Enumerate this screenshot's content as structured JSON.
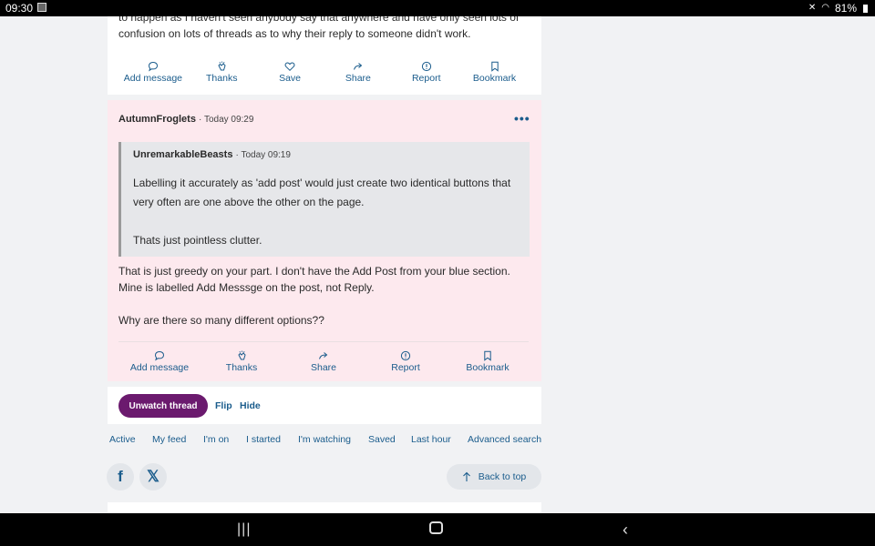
{
  "status_bar": {
    "time": "09:30",
    "battery": "81%"
  },
  "post1": {
    "text_lines": [
      "to happen as I haven't seen anybody say that anywhere and have only seen lots of",
      "confusion on lots of threads as to why their reply to someone didn't work."
    ],
    "actions": [
      "Add message",
      "Thanks",
      "Save",
      "Share",
      "Report",
      "Bookmark"
    ]
  },
  "post2": {
    "author": "AutumnFroglets",
    "time": "· Today 09:29",
    "more": "•••",
    "quote": {
      "author": "UnremarkableBeasts",
      "time": "· Today 09:19",
      "lines": [
        "Labelling it accurately as 'add post' would just create two identical buttons that",
        "very often are one above the other on the page.",
        "Thats just pointless clutter."
      ]
    },
    "body_lines": [
      "That is just greedy on your part. I don't have the Add Post from your blue section.",
      "Mine is labelled Add Messsge on the post, not Reply.",
      "Why are there so many different options??"
    ],
    "actions": [
      "Add message",
      "Thanks",
      "Share",
      "Report",
      "Bookmark"
    ]
  },
  "thread_controls": {
    "unwatch": "Unwatch thread",
    "flip": "Flip",
    "hide": "Hide"
  },
  "footer_links": [
    "Active",
    "My feed",
    "I'm on",
    "I started",
    "I'm watching",
    "Saved",
    "Last hour",
    "Advanced search"
  ],
  "social": {
    "facebook": "f",
    "x": "𝕏"
  },
  "back_to_top": "Back to top",
  "colors": {
    "link": "#1a5c8c",
    "unwatch_bg": "#6b1a6e",
    "post_highlight": "#fde9ee"
  }
}
